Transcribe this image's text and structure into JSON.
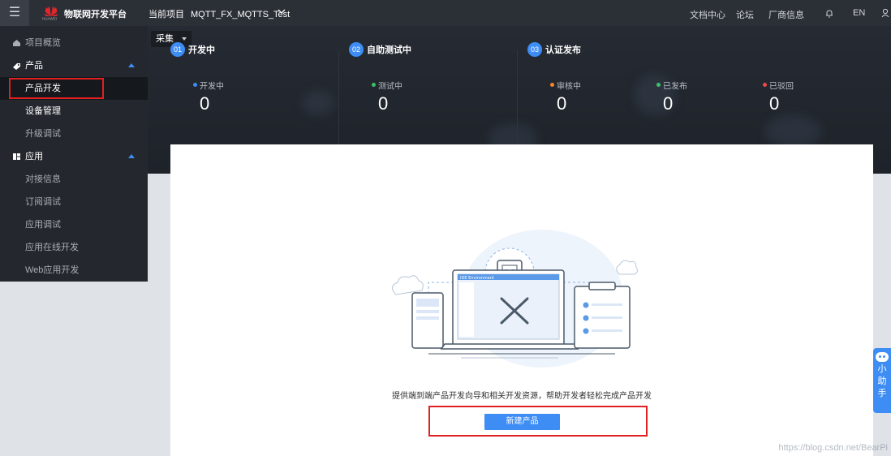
{
  "topbar": {
    "menu_icon": "☰",
    "logo_text": "HUAWEI",
    "brand": "物联网开发平台",
    "project_label": "当前项目",
    "project_name": "MQTT_FX_MQTTS_Test",
    "links": [
      "文档中心",
      "论坛",
      "厂商信息"
    ],
    "lang": "EN"
  },
  "sidebar": {
    "items": [
      {
        "label": "项目概览",
        "icon": "home-icon"
      },
      {
        "label": "产品",
        "icon": "product-icon"
      },
      {
        "label": "产品开发"
      },
      {
        "label": "设备管理"
      },
      {
        "label": "升级调试"
      },
      {
        "label": "应用",
        "icon": "apps-icon"
      },
      {
        "label": "对接信息"
      },
      {
        "label": "订阅调试"
      },
      {
        "label": "应用调试"
      },
      {
        "label": "应用在线开发"
      },
      {
        "label": "Web应用开发"
      }
    ]
  },
  "hero": {
    "collect_label": "采集",
    "stages": [
      {
        "num": "01",
        "title": "开发中",
        "stats": [
          {
            "label": "开发中",
            "value": "0",
            "color": "#3d8df5"
          }
        ]
      },
      {
        "num": "02",
        "title": "自助测试中",
        "stats": [
          {
            "label": "测试中",
            "value": "0",
            "color": "#3cc065"
          }
        ]
      },
      {
        "num": "03",
        "title": "认证发布",
        "stats": [
          {
            "label": "审核中",
            "value": "0",
            "color": "#f5862b"
          },
          {
            "label": "已发布",
            "value": "0",
            "color": "#3cc065"
          },
          {
            "label": "已驳回",
            "value": "0",
            "color": "#f04848"
          }
        ]
      }
    ]
  },
  "panel": {
    "screen_title": "IDE Environment",
    "description": "提供端到端产品开发向导和相关开发资源，帮助开发者轻松完成产品开发",
    "new_product_button": "新建产品"
  },
  "assistant": {
    "chars": [
      "小",
      "助",
      "手"
    ]
  },
  "watermark": "https://blog.csdn.net/BearPi"
}
